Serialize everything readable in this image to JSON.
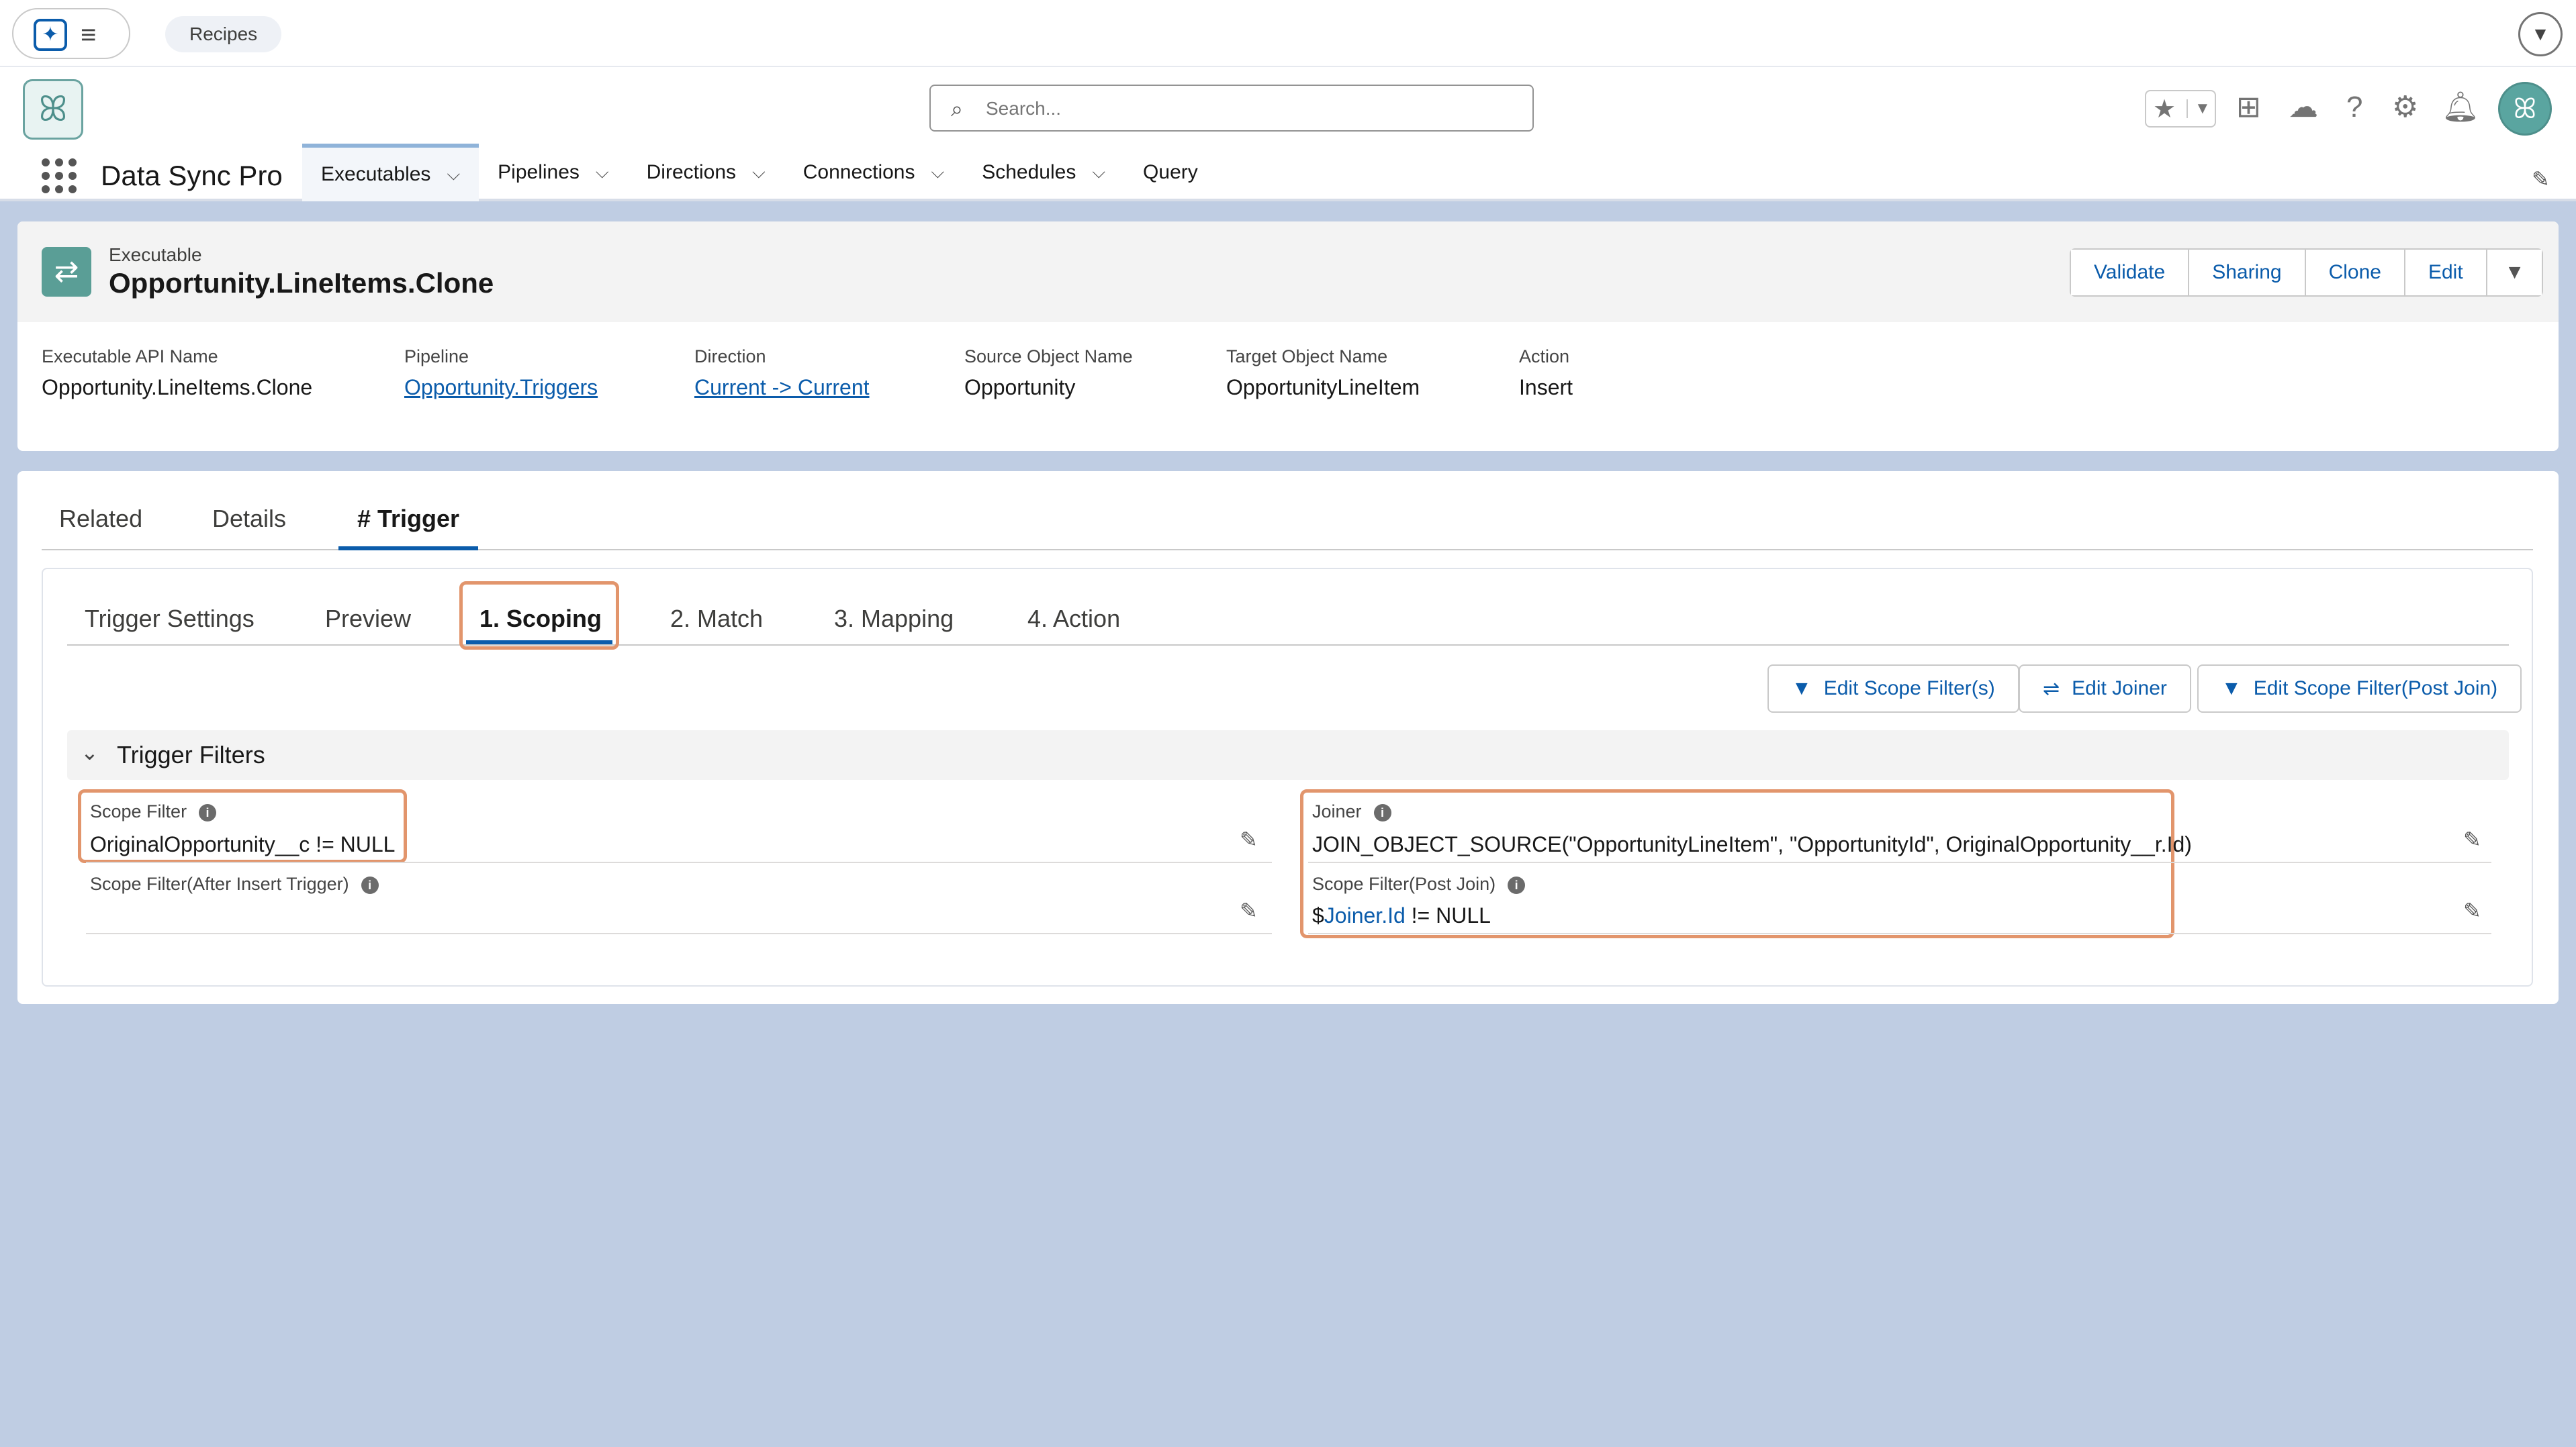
{
  "utility": {
    "recipes_label": "Recipes"
  },
  "header": {
    "app_name": "Data Sync Pro",
    "search_placeholder": "Search...",
    "nav": [
      {
        "label": "Executables",
        "dropdown": true,
        "active": true
      },
      {
        "label": "Pipelines",
        "dropdown": true
      },
      {
        "label": "Directions",
        "dropdown": true
      },
      {
        "label": "Connections",
        "dropdown": true
      },
      {
        "label": "Schedules",
        "dropdown": true
      },
      {
        "label": "Query",
        "dropdown": false
      }
    ]
  },
  "record": {
    "object_label": "Executable",
    "name": "Opportunity.LineItems.Clone",
    "actions": [
      "Validate",
      "Sharing",
      "Clone",
      "Edit"
    ],
    "fields": [
      {
        "label": "Executable API Name",
        "value": "Opportunity.LineItems.Clone",
        "link": false
      },
      {
        "label": "Pipeline",
        "value": "Opportunity.Triggers",
        "link": true
      },
      {
        "label": "Direction",
        "value": "Current -> Current",
        "link": true
      },
      {
        "label": "Source Object Name",
        "value": "Opportunity",
        "link": false
      },
      {
        "label": "Target Object Name",
        "value": "OpportunityLineItem",
        "link": false
      },
      {
        "label": "Action",
        "value": "Insert",
        "link": false
      }
    ]
  },
  "tabs": {
    "primary": [
      "Related",
      "Details",
      "# Trigger"
    ],
    "primary_active": "# Trigger",
    "secondary": [
      "Trigger Settings",
      "Preview",
      "1. Scoping",
      "2. Match",
      "3. Mapping",
      "4. Action"
    ],
    "secondary_active": "1. Scoping"
  },
  "scoping": {
    "buttons": [
      "Edit Scope Filter(s)",
      "Edit Joiner",
      "Edit Scope Filter(Post Join)"
    ],
    "section_title": "Trigger Filters",
    "scope_filter": {
      "label": "Scope Filter",
      "value": "OriginalOpportunity__c != NULL"
    },
    "scope_filter_after_insert": {
      "label": "Scope Filter(After Insert Trigger)",
      "value": ""
    },
    "joiner": {
      "label": "Joiner",
      "value": "JOIN_OBJECT_SOURCE(\"OpportunityLineItem\", \"OpportunityId\", OriginalOpportunity__r.Id)"
    },
    "scope_filter_post_join": {
      "label": "Scope Filter(Post Join)",
      "value_prefix": "$",
      "value_link": "Joiner.Id",
      "value_suffix": " != NULL"
    }
  },
  "icons": {
    "app_launcher": "waffle-icon",
    "search": "search-icon",
    "favorites": "star-icon",
    "add": "plus-icon",
    "trailhead": "cloud-icon",
    "help": "question-icon",
    "setup": "gear-icon",
    "notifications": "bell-icon",
    "edit": "pencil-icon",
    "filter": "filter-icon",
    "joiner": "joiner-icon"
  },
  "colors": {
    "brand": "#0b5cab",
    "highlight": "#e2956c",
    "background": "#bfcde3"
  }
}
